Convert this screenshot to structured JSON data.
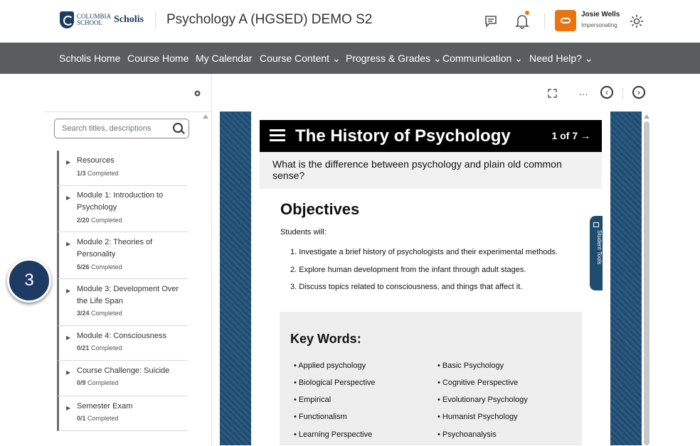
{
  "header": {
    "logo_line1": "COLUMBIA",
    "logo_line2": "SCHOOL",
    "logo_brand": "Scholis",
    "course_title": "Psychology A (HGSED) DEMO S2",
    "user_name": "Josie Wells",
    "user_status": "Impersonating",
    "accent_color": "#e87511"
  },
  "nav": {
    "items": [
      {
        "label": "Scholis Home"
      },
      {
        "label": "Course Home"
      },
      {
        "label": "My Calendar"
      },
      {
        "label": "Course Content ⌄"
      },
      {
        "label": "Progress & Grades ⌄"
      },
      {
        "label": "Communication ⌄"
      },
      {
        "label": "Need Help? ⌄"
      }
    ]
  },
  "sidebar": {
    "search_placeholder": "Search titles, descriptions",
    "items": [
      {
        "title": "Resources",
        "progress": "1/3",
        "completed": "Completed"
      },
      {
        "title": "Module 1: Introduction to Psychology",
        "progress": "2/20",
        "completed": "Completed"
      },
      {
        "title": "Module 2: Theories of Personality",
        "progress": "5/26",
        "completed": "Completed"
      },
      {
        "title": "Module 3: Development Over the Life Span",
        "progress": "3/24",
        "completed": "Completed"
      },
      {
        "title": "Module 4: Consciousness",
        "progress": "0/21",
        "completed": "Completed"
      },
      {
        "title": "Course Challenge: Suicide",
        "progress": "0/9",
        "completed": "Completed"
      },
      {
        "title": "Semester Exam",
        "progress": "0/1",
        "completed": "Completed"
      }
    ]
  },
  "step_badge": "3",
  "content": {
    "title": "The History of Psychology",
    "page": "1 of 7 →",
    "question": "What is the difference between psychology and plain old common sense?",
    "objectives_title": "Objectives",
    "objectives_intro": "Students will:",
    "objectives": [
      "1. Investigate a brief history of psychologists and their experimental methods.",
      "2. Explore human development from the infant through adult stages.",
      "3. Discuss topics related to consciousness, and things that affect it."
    ],
    "keywords_title": "Key Words:",
    "keywords_left": [
      "• Applied psychology",
      "• Biological Perspective",
      "• Empirical",
      "• Functionalism",
      "• Learning Perspective"
    ],
    "keywords_right": [
      "• Basic Psychology",
      "• Cognitive Perspective",
      "• Evolutionary Psychology",
      "• Humanist Psychology",
      "• Psychoanalysis"
    ],
    "student_tools": "Student Tools"
  }
}
